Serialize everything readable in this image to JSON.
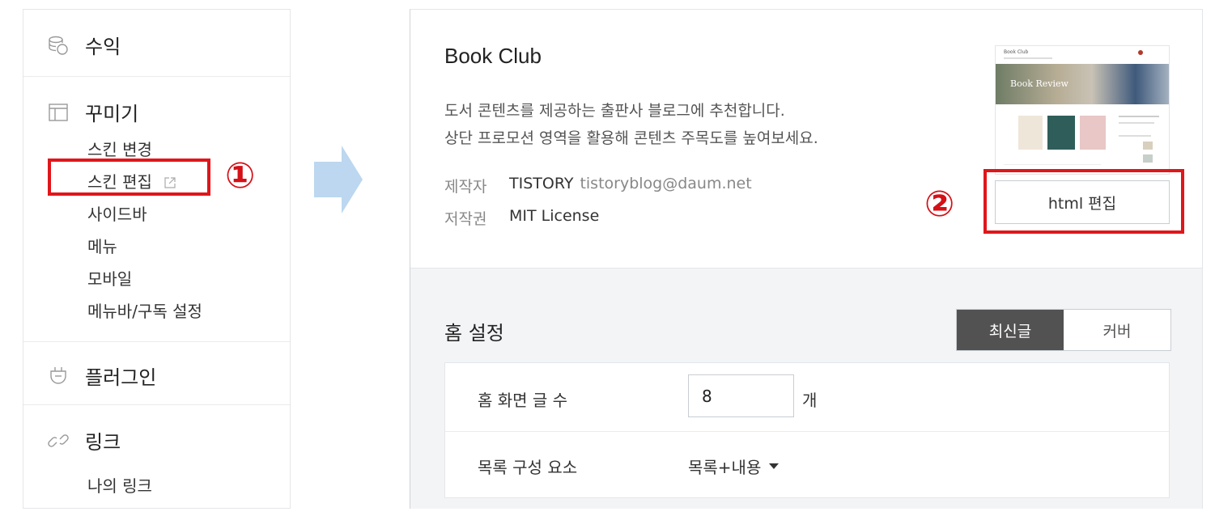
{
  "sidebar": {
    "revenue": {
      "title": "수익",
      "icon": "coins-icon"
    },
    "customize": {
      "title": "꾸미기",
      "icon": "layout-icon",
      "items": [
        "스킨 변경",
        "스킨 편집",
        "사이드바",
        "메뉴",
        "모바일",
        "메뉴바/구독 설정"
      ]
    },
    "plugin": {
      "title": "플러그인",
      "icon": "plug-icon"
    },
    "link": {
      "title": "링크",
      "icon": "link-icon",
      "items": [
        "나의 링크"
      ]
    }
  },
  "annotations": {
    "step1": "①",
    "step2": "②"
  },
  "skin": {
    "name": "Book Club",
    "desc1": "도서 콘텐츠를 제공하는 출판사 블로그에 추천합니다.",
    "desc2": "상단 프로모션 영역을 활용해 콘텐츠 주목도를 높여보세요.",
    "maker_label": "제작자",
    "maker": "TISTORY",
    "maker_email": "tistoryblog@daum.net",
    "license_label": "저작권",
    "license": "MIT License",
    "edit_button": "html 편집",
    "thumb": {
      "site_title": "Book Club",
      "banner_text": "Book Review"
    }
  },
  "home": {
    "title": "홈 설정",
    "tabs": {
      "active": "최신글",
      "inactive": "커버"
    },
    "post_count_label": "홈 화면 글 수",
    "post_count": "8",
    "post_count_unit": "개",
    "list_label": "목록 구성 요소",
    "list_value": "목록+내용"
  },
  "colors": {
    "highlight": "#e0161b",
    "arrow": "#bcd7ef",
    "tab_active": "#525252"
  }
}
